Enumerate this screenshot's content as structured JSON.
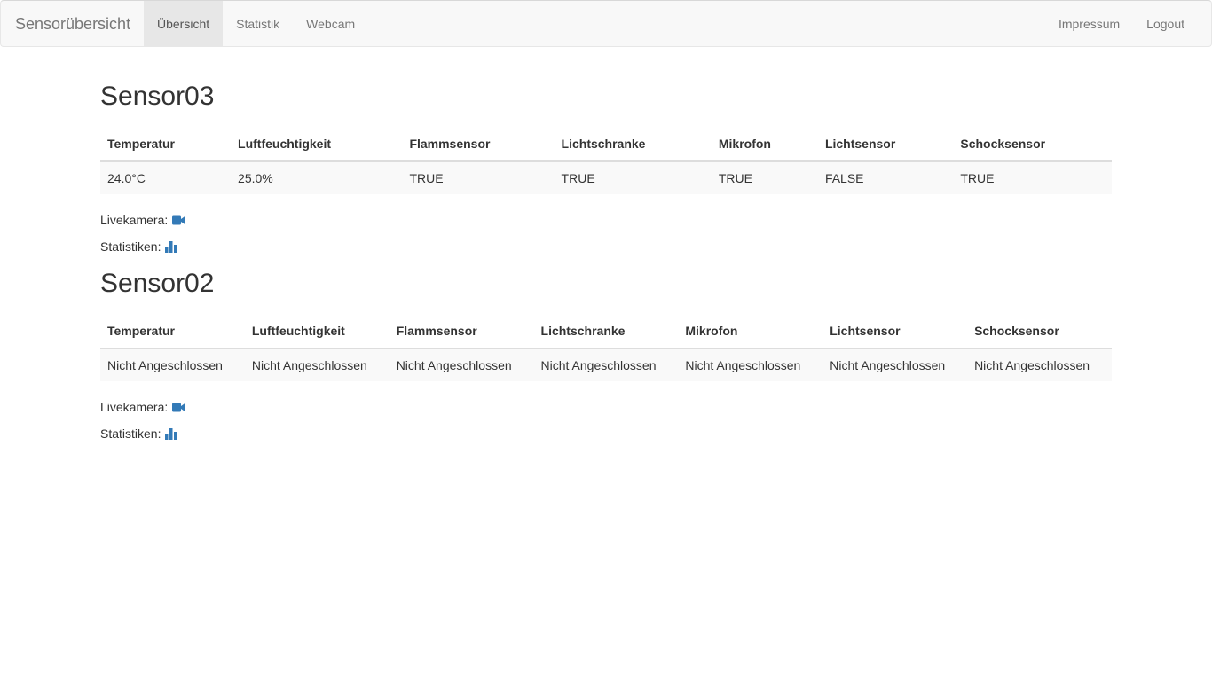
{
  "navbar": {
    "brand": "Sensorübersicht",
    "left_items": [
      {
        "label": "Übersicht",
        "active": true
      },
      {
        "label": "Statistik",
        "active": false
      },
      {
        "label": "Webcam",
        "active": false
      }
    ],
    "right_items": [
      {
        "label": "Impressum"
      },
      {
        "label": "Logout"
      }
    ]
  },
  "sensors": [
    {
      "title": "Sensor03",
      "headers": [
        "Temperatur",
        "Luftfeuchtigkeit",
        "Flammsensor",
        "Lichtschranke",
        "Mikrofon",
        "Lichtsensor",
        "Schocksensor"
      ],
      "values": [
        "24.0°C",
        "25.0%",
        "TRUE",
        "TRUE",
        "TRUE",
        "FALSE",
        "TRUE"
      ],
      "livecam_label": "Livekamera:",
      "stats_label": "Statistiken:"
    },
    {
      "title": "Sensor02",
      "headers": [
        "Temperatur",
        "Luftfeuchtigkeit",
        "Flammsensor",
        "Lichtschranke",
        "Mikrofon",
        "Lichtsensor",
        "Schocksensor"
      ],
      "values": [
        "Nicht Angeschlossen",
        "Nicht Angeschlossen",
        "Nicht Angeschlossen",
        "Nicht Angeschlossen",
        "Nicht Angeschlossen",
        "Nicht Angeschlossen",
        "Nicht Angeschlossen"
      ],
      "livecam_label": "Livekamera:",
      "stats_label": "Statistiken:"
    }
  ],
  "icons": {
    "camera": "video-camera-icon",
    "stats": "bar-chart-icon"
  },
  "colors": {
    "icon_blue": "#337ab7",
    "navbar_bg": "#f8f8f8",
    "active_tab_bg": "#e7e7e7"
  }
}
